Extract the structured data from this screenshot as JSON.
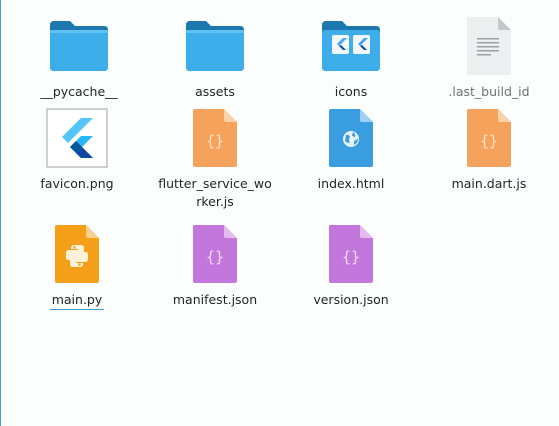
{
  "files": [
    {
      "name": "__pycache__",
      "type": "folder",
      "icon": "folder-icon"
    },
    {
      "name": "assets",
      "type": "folder",
      "icon": "folder-icon"
    },
    {
      "name": "icons",
      "type": "folder",
      "icon": "flutter-folder-icon"
    },
    {
      "name": ".last_build_id",
      "type": "text",
      "icon": "text-file-icon",
      "hidden": true
    },
    {
      "name": "favicon.png",
      "type": "image",
      "icon": "flutter-logo-image-icon"
    },
    {
      "name": "flutter_service_worker.js",
      "type": "javascript",
      "icon": "javascript-file-icon"
    },
    {
      "name": "index.html",
      "type": "html",
      "icon": "html-file-icon"
    },
    {
      "name": "main.dart.js",
      "type": "javascript",
      "icon": "javascript-file-icon"
    },
    {
      "name": "main.py",
      "type": "python",
      "icon": "python-file-icon",
      "focused": true
    },
    {
      "name": "manifest.json",
      "type": "json",
      "icon": "json-file-icon"
    },
    {
      "name": "version.json",
      "type": "json",
      "icon": "json-file-icon"
    }
  ],
  "labels": {
    "pycache": "__pycache__",
    "assets": "assets",
    "icons": "icons",
    "last_build_id": ".last_build_id",
    "favicon": "favicon.png",
    "service_worker": "flutter_service_worker.js",
    "index_html": "index.html",
    "main_dart_js": "main.dart.js",
    "main_py": "main.py",
    "manifest": "manifest.json",
    "version": "version.json"
  },
  "colors": {
    "folder": "#3daee9",
    "folder_dark": "#1d78b0",
    "javascript": "#f5a25c",
    "html": "#3a9de0",
    "python": "#f6a01a",
    "json": "#c376dc",
    "focus_underline": "#3d9bd8"
  }
}
